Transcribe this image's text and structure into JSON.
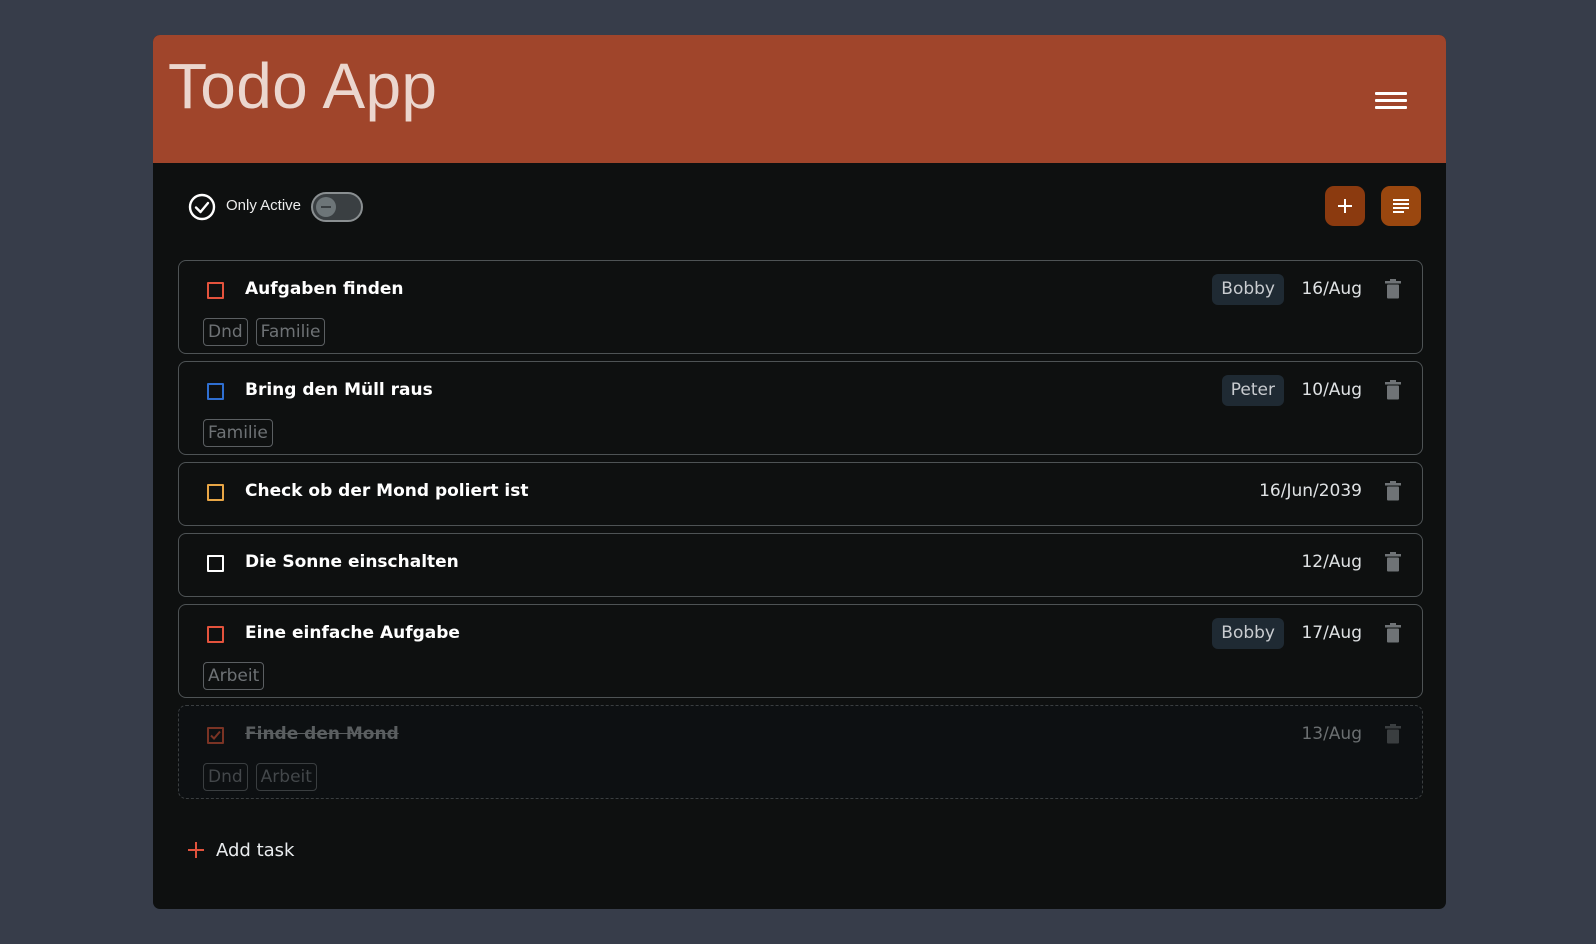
{
  "header": {
    "title": "Todo App",
    "menu_icon": "hamburger-menu-icon"
  },
  "toolbar": {
    "only_active_label": "Only Active",
    "only_active_enabled": false,
    "add_button_icon": "plus-icon",
    "sort_button_icon": "list-icon"
  },
  "tasks": [
    {
      "title": "Aufgaben finden",
      "assignee": "Bobby",
      "date": "16/Aug",
      "tags": [
        "Dnd",
        "Familie"
      ],
      "done": false,
      "priority_color": "#e4533d"
    },
    {
      "title": "Bring den Müll raus",
      "assignee": "Peter",
      "date": "10/Aug",
      "tags": [
        "Familie"
      ],
      "done": false,
      "priority_color": "#2f6fd1"
    },
    {
      "title": "Check ob der Mond poliert ist",
      "assignee": "",
      "date": "16/Jun/2039",
      "tags": [],
      "done": false,
      "priority_color": "#e8a646"
    },
    {
      "title": "Die Sonne einschalten",
      "assignee": "",
      "date": "12/Aug",
      "tags": [],
      "done": false,
      "priority_color": "#ffffff"
    },
    {
      "title": "Eine einfache Aufgabe",
      "assignee": "Bobby",
      "date": "17/Aug",
      "tags": [
        "Arbeit"
      ],
      "done": false,
      "priority_color": "#e4533d"
    },
    {
      "title": "Finde den Mond",
      "assignee": "",
      "date": "13/Aug",
      "tags": [
        "Dnd",
        "Arbeit"
      ],
      "done": true,
      "priority_color": "#7a3324"
    }
  ],
  "add_task": {
    "label": "Add task"
  },
  "colors": {
    "page_bg": "#373d4a",
    "header_bg": "#a0452b",
    "panel_bg": "#0e1010",
    "accent": "#e4533d",
    "button_bg": "#8b3a0f"
  }
}
